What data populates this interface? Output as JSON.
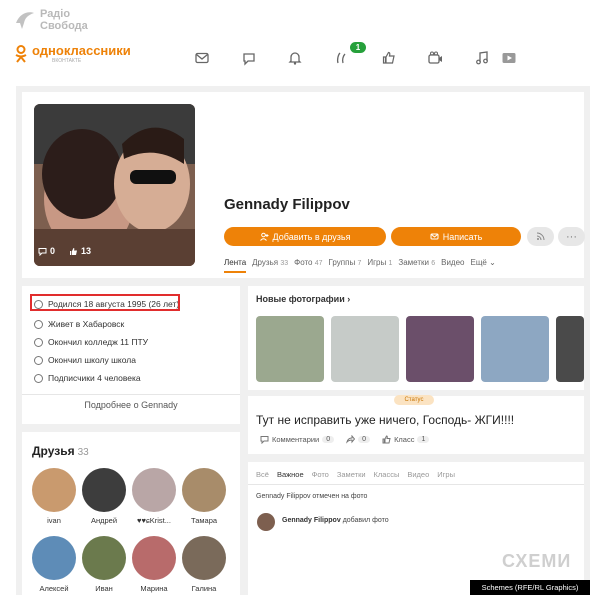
{
  "watermark": {
    "line1": "Радіо",
    "line2": "Свобода"
  },
  "header": {
    "brand": "одноклассники",
    "brand_sub": "ВКОНТАКТЕ",
    "notif_count": "1",
    "icons": [
      "mail-icon",
      "chat-icon",
      "bell-icon",
      "guests-icon",
      "like-icon",
      "video-icon",
      "music-icon",
      "video-player-icon"
    ]
  },
  "profile": {
    "name": "Gennady Filippov",
    "photo_comments": "0",
    "photo_likes": "13",
    "add_friend_label": "Добавить в друзья",
    "write_label": "Написать",
    "more_label": "···",
    "tabs": [
      {
        "label": "Лента",
        "count": ""
      },
      {
        "label": "Друзья",
        "count": "33"
      },
      {
        "label": "Фото",
        "count": "47"
      },
      {
        "label": "Группы",
        "count": "7"
      },
      {
        "label": "Игры",
        "count": "1"
      },
      {
        "label": "Заметки",
        "count": "6"
      },
      {
        "label": "Видео",
        "count": ""
      },
      {
        "label": "Ещё",
        "count": ""
      }
    ]
  },
  "about": {
    "born": "Родился 18 августа 1995 (26 лет)",
    "lives": "Живет в Хабаровск",
    "college": "Окончил колледж 11 ПТУ",
    "school": "Окончил школу школа",
    "subscribers": "Подписчики 4 человека",
    "more": "Подробнее о Gennady"
  },
  "friends": {
    "title": "Друзья",
    "count": "33",
    "items": [
      {
        "name": "ivan",
        "color": "#c99a6e"
      },
      {
        "name": "Андрей",
        "color": "#3d3d3d"
      },
      {
        "name": "♥♥ɕKrist...",
        "color": "#b9a6a6"
      },
      {
        "name": "Тамара",
        "color": "#a88c6a"
      },
      {
        "name": "Алексей",
        "color": "#5e8cb7"
      },
      {
        "name": "Иван",
        "color": "#6b7a4d"
      },
      {
        "name": "Марина",
        "color": "#b86b6b"
      },
      {
        "name": "Галина",
        "color": "#7a6a5a"
      }
    ]
  },
  "photos": {
    "title": "Новые фотографии",
    "thumbs": [
      "#9ba88f",
      "#c6cbc8",
      "#6b4f6a",
      "#a17b88",
      "#8da7c2",
      "#4a4a4a"
    ]
  },
  "status": {
    "tag": "Статус",
    "text": "Тут не исправить уже ничего, Господь- ЖГИ!!!!",
    "comments_label": "Комментарии",
    "comments_count": "0",
    "shares_count": "0",
    "class_label": "Класс",
    "class_count": "1"
  },
  "feed": {
    "tabs": [
      "Всё",
      "Важное",
      "Фото",
      "Заметки",
      "Классы",
      "Видео",
      "Игры"
    ],
    "line1": "Gennady Filippov отмечен на фото",
    "line2_name": "Gennady Filippov",
    "line2_rest": "добавил фото"
  },
  "branding": {
    "schemes": "СХЕМИ",
    "credit": "Schemes (RFE/RL Graphics)"
  }
}
